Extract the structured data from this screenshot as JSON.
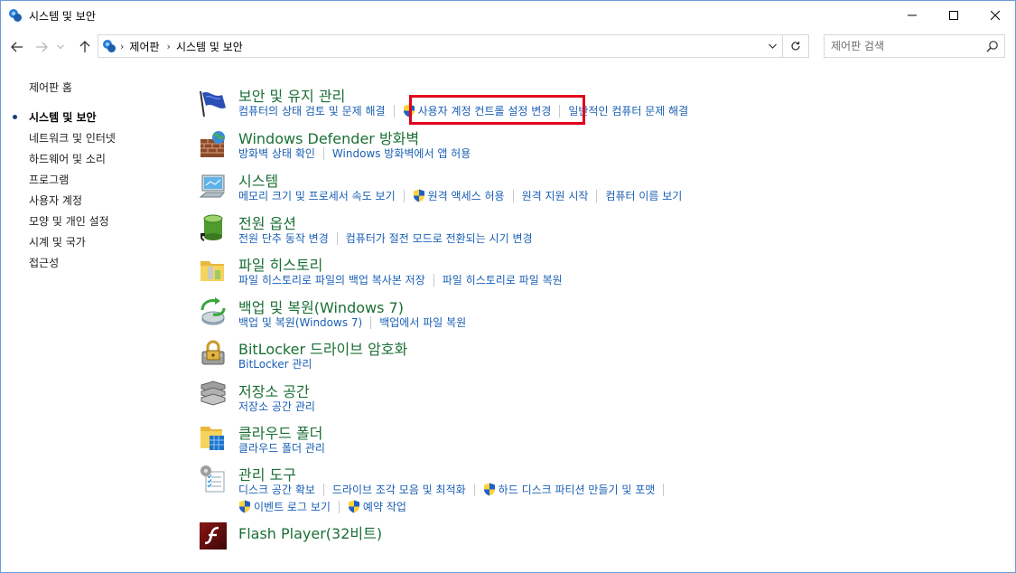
{
  "window": {
    "title": "시스템 및 보안",
    "controls": {
      "minimize": "minimize-icon",
      "maximize": "maximize-icon",
      "close": "close-icon"
    }
  },
  "nav": {
    "breadcrumb": [
      "제어판",
      "시스템 및 보안"
    ],
    "search_placeholder": "제어판 검색"
  },
  "sidebar": {
    "items": [
      {
        "label": "제어판 홈",
        "current": false
      },
      {
        "label": "시스템 및 보안",
        "current": true
      },
      {
        "label": "네트워크 및 인터넷",
        "current": false
      },
      {
        "label": "하드웨어 및 소리",
        "current": false
      },
      {
        "label": "프로그램",
        "current": false
      },
      {
        "label": "사용자 계정",
        "current": false
      },
      {
        "label": "모양 및 개인 설정",
        "current": false
      },
      {
        "label": "시계 및 국가",
        "current": false
      },
      {
        "label": "접근성",
        "current": false
      }
    ]
  },
  "categories": [
    {
      "title": "보안 및 유지 관리",
      "icon": "flag-icon",
      "rows": [
        [
          {
            "text": "컴퓨터의 상태 검토 및 문제 해결",
            "shield": false
          },
          {
            "text": "사용자 계정 컨트롤 설정 변경",
            "shield": true
          },
          {
            "text": "일반적인 컴퓨터 문제 해결",
            "shield": false
          }
        ]
      ]
    },
    {
      "title": "Windows Defender 방화벽",
      "icon": "firewall-icon",
      "rows": [
        [
          {
            "text": "방화벽 상태 확인",
            "shield": false
          },
          {
            "text": "Windows 방화벽에서 앱 허용",
            "shield": false
          }
        ]
      ]
    },
    {
      "title": "시스템",
      "icon": "computer-icon",
      "rows": [
        [
          {
            "text": "메모리 크기 및 프로세서 속도 보기",
            "shield": false
          },
          {
            "text": "원격 액세스 허용",
            "shield": true
          },
          {
            "text": "원격 지원 시작",
            "shield": false
          },
          {
            "text": "컴퓨터 이름 보기",
            "shield": false
          }
        ]
      ]
    },
    {
      "title": "전원 옵션",
      "icon": "battery-icon",
      "rows": [
        [
          {
            "text": "전원 단추 동작 변경",
            "shield": false
          },
          {
            "text": "컴퓨터가 절전 모드로 전환되는 시기 변경",
            "shield": false
          }
        ]
      ]
    },
    {
      "title": "파일 히스토리",
      "icon": "file-history-icon",
      "rows": [
        [
          {
            "text": "파일 히스토리로 파일의 백업 복사본 저장",
            "shield": false
          },
          {
            "text": "파일 히스토리로 파일 복원",
            "shield": false
          }
        ]
      ]
    },
    {
      "title": "백업 및 복원(Windows 7)",
      "icon": "backup-icon",
      "rows": [
        [
          {
            "text": "백업 및 복원(Windows 7)",
            "shield": false
          },
          {
            "text": "백업에서 파일 복원",
            "shield": false
          }
        ]
      ]
    },
    {
      "title": "BitLocker 드라이브 암호화",
      "icon": "bitlocker-icon",
      "rows": [
        [
          {
            "text": "BitLocker 관리",
            "shield": false
          }
        ]
      ]
    },
    {
      "title": "저장소 공간",
      "icon": "storage-icon",
      "rows": [
        [
          {
            "text": "저장소 공간 관리",
            "shield": false
          }
        ]
      ]
    },
    {
      "title": "클라우드 폴더",
      "icon": "work-folders-icon",
      "rows": [
        [
          {
            "text": "클라우드 폴더 관리",
            "shield": false
          }
        ]
      ]
    },
    {
      "title": "관리 도구",
      "icon": "admin-tools-icon",
      "rows": [
        [
          {
            "text": "디스크 공간 확보",
            "shield": false
          },
          {
            "text": "드라이브 조각 모음 및 최적화",
            "shield": false
          },
          {
            "text": "하드 디스크 파티션 만들기 및 포맷",
            "shield": true
          }
        ],
        [
          {
            "text": "이벤트 로그 보기",
            "shield": true
          },
          {
            "text": "예약 작업",
            "shield": true
          }
        ]
      ]
    },
    {
      "title": "Flash Player(32비트)",
      "icon": "flash-icon",
      "rows": []
    }
  ],
  "highlight": {
    "target": "사용자 계정 컨트롤 설정 변경",
    "color": "#e3001b"
  },
  "colors": {
    "category_title": "#1b6f35",
    "link": "#1a5fb4"
  }
}
